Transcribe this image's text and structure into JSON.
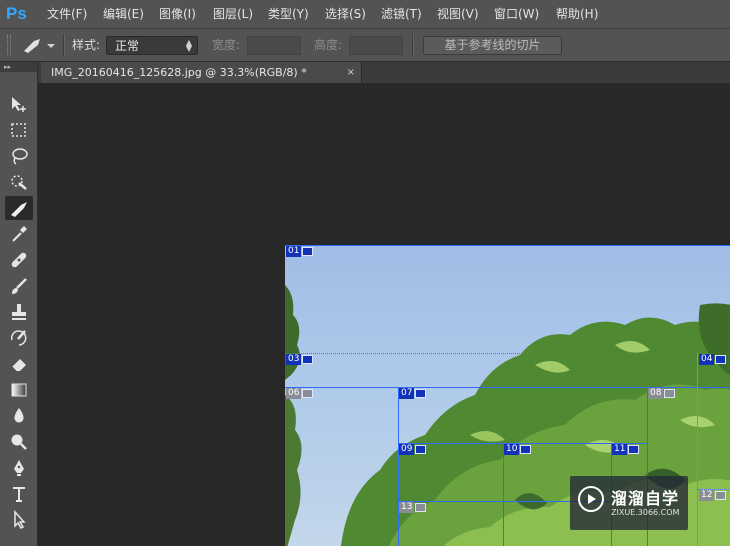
{
  "app": {
    "logo": "Ps",
    "logo_color": "#31a8ff"
  },
  "menu": [
    {
      "label": "文件(F)"
    },
    {
      "label": "编辑(E)"
    },
    {
      "label": "图像(I)"
    },
    {
      "label": "图层(L)"
    },
    {
      "label": "类型(Y)"
    },
    {
      "label": "选择(S)"
    },
    {
      "label": "滤镜(T)"
    },
    {
      "label": "视图(V)"
    },
    {
      "label": "窗口(W)"
    },
    {
      "label": "帮助(H)"
    }
  ],
  "options": {
    "style_label": "样式:",
    "style_value": "正常",
    "width_label": "宽度:",
    "width_value": "",
    "height_label": "高度:",
    "height_value": "",
    "slices_button": "基于参考线的切片"
  },
  "toolbar_collapse": "▸▸",
  "tools": [
    {
      "icon": "move-tool-icon"
    },
    {
      "icon": "marquee-tool-icon"
    },
    {
      "icon": "lasso-tool-icon"
    },
    {
      "icon": "quick-selection-tool-icon"
    },
    {
      "icon": "slice-tool-icon",
      "active": true
    },
    {
      "icon": "eyedropper-tool-icon"
    },
    {
      "icon": "healing-brush-tool-icon"
    },
    {
      "icon": "brush-tool-icon"
    },
    {
      "icon": "clone-stamp-tool-icon"
    },
    {
      "icon": "history-brush-tool-icon"
    },
    {
      "icon": "eraser-tool-icon"
    },
    {
      "icon": "gradient-tool-icon"
    },
    {
      "icon": "blur-tool-icon"
    },
    {
      "icon": "dodge-tool-icon"
    },
    {
      "icon": "pen-tool-icon"
    },
    {
      "icon": "type-tool-icon"
    },
    {
      "icon": "path-selection-tool-icon"
    }
  ],
  "document": {
    "tab_title": "IMG_20160416_125628.jpg @ 33.3%(RGB/8) *",
    "close_glyph": "×"
  },
  "slices": [
    {
      "num": "01",
      "kind": "user"
    },
    {
      "num": "03",
      "kind": "user"
    },
    {
      "num": "04",
      "kind": "user"
    },
    {
      "num": "06",
      "kind": "auto"
    },
    {
      "num": "07",
      "kind": "user"
    },
    {
      "num": "08",
      "kind": "auto"
    },
    {
      "num": "09",
      "kind": "user"
    },
    {
      "num": "10",
      "kind": "user"
    },
    {
      "num": "11",
      "kind": "user"
    },
    {
      "num": "12",
      "kind": "auto"
    },
    {
      "num": "13",
      "kind": "auto"
    }
  ],
  "watermark": {
    "title": "溜溜自学",
    "subtitle": "ZIXUE.3066.COM"
  },
  "colors": {
    "slice_user": "#1233b8",
    "slice_auto": "#8b8d94",
    "slice_line": "#2f6bff",
    "panel": "#535353",
    "canvas": "#282828"
  }
}
